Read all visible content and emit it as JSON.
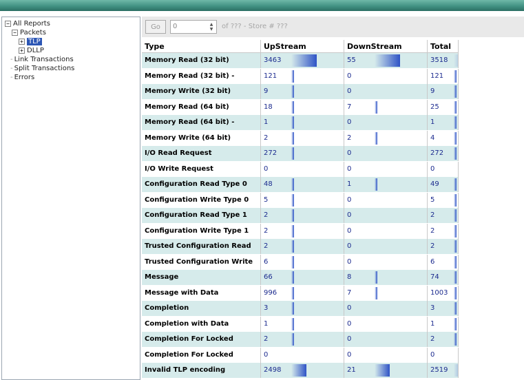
{
  "tree": {
    "root": "All Reports",
    "packets": "Packets",
    "tlp": "TLP",
    "dllp": "DLLP",
    "link": "Link Transactions",
    "split": "Split Transactions",
    "errors": "Errors"
  },
  "toolbar": {
    "go_label": "Go",
    "spin_value": "0",
    "of_text": "of ??? - Store # ???"
  },
  "table": {
    "headers": [
      "Type",
      "UpStream",
      "DownStream",
      "Total"
    ],
    "rows": [
      {
        "type": "Memory Read (32 bit)",
        "up": "3463",
        "down": "55",
        "total": "3518",
        "up_frac": 0.6,
        "down_frac": 0.6,
        "total_frac": 1.0
      },
      {
        "type": "Memory Read (32 bit) -",
        "up": "121",
        "down": "0",
        "total": "121",
        "up_frac": 0.05,
        "down_frac": 0,
        "total_frac": 0.05
      },
      {
        "type": "Memory Write (32 bit)",
        "up": "9",
        "down": "0",
        "total": "9",
        "up_frac": 0.02,
        "down_frac": 0,
        "total_frac": 0.02
      },
      {
        "type": "Memory Read (64 bit)",
        "up": "18",
        "down": "7",
        "total": "25",
        "up_frac": 0.02,
        "down_frac": 0.05,
        "total_frac": 0.02
      },
      {
        "type": "Memory Read (64 bit) -",
        "up": "1",
        "down": "0",
        "total": "1",
        "up_frac": 0.02,
        "down_frac": 0,
        "total_frac": 0.02
      },
      {
        "type": "Memory Write (64 bit)",
        "up": "2",
        "down": "2",
        "total": "4",
        "up_frac": 0.02,
        "down_frac": 0.02,
        "total_frac": 0.02
      },
      {
        "type": "I/O Read Request",
        "up": "272",
        "down": "0",
        "total": "272",
        "up_frac": 0.05,
        "down_frac": 0,
        "total_frac": 0.05
      },
      {
        "type": "I/O Write Request",
        "up": "0",
        "down": "0",
        "total": "0",
        "up_frac": 0,
        "down_frac": 0,
        "total_frac": 0
      },
      {
        "type": "Configuration Read Type 0",
        "up": "48",
        "down": "1",
        "total": "49",
        "up_frac": 0.02,
        "down_frac": 0.05,
        "total_frac": 0.02
      },
      {
        "type": "Configuration Write Type 0",
        "up": "5",
        "down": "0",
        "total": "5",
        "up_frac": 0.02,
        "down_frac": 0,
        "total_frac": 0.02
      },
      {
        "type": "Configuration Read Type 1",
        "up": "2",
        "down": "0",
        "total": "2",
        "up_frac": 0.02,
        "down_frac": 0,
        "total_frac": 0.02
      },
      {
        "type": "Configuration Write Type 1",
        "up": "2",
        "down": "0",
        "total": "2",
        "up_frac": 0.02,
        "down_frac": 0,
        "total_frac": 0.02
      },
      {
        "type": "Trusted Configuration Read",
        "up": "2",
        "down": "0",
        "total": "2",
        "up_frac": 0.02,
        "down_frac": 0,
        "total_frac": 0.02
      },
      {
        "type": "Trusted Configuration Write",
        "up": "6",
        "down": "0",
        "total": "6",
        "up_frac": 0.02,
        "down_frac": 0,
        "total_frac": 0.02
      },
      {
        "type": "Message",
        "up": "66",
        "down": "8",
        "total": "74",
        "up_frac": 0.02,
        "down_frac": 0.05,
        "total_frac": 0.02
      },
      {
        "type": "Message with Data",
        "up": "996",
        "down": "7",
        "total": "1003",
        "up_frac": 0.05,
        "down_frac": 0.05,
        "total_frac": 0.05
      },
      {
        "type": "Completion",
        "up": "3",
        "down": "0",
        "total": "3",
        "up_frac": 0.02,
        "down_frac": 0,
        "total_frac": 0.02
      },
      {
        "type": "Completion with Data",
        "up": "1",
        "down": "0",
        "total": "1",
        "up_frac": 0.02,
        "down_frac": 0,
        "total_frac": 0.02
      },
      {
        "type": "Completion For Locked",
        "up": "2",
        "down": "0",
        "total": "2",
        "up_frac": 0.02,
        "down_frac": 0,
        "total_frac": 0.02
      },
      {
        "type": "Completion For Locked",
        "up": "0",
        "down": "0",
        "total": "0",
        "up_frac": 0,
        "down_frac": 0,
        "total_frac": 0
      },
      {
        "type": "Invalid TLP encoding",
        "up": "2498",
        "down": "21",
        "total": "2519",
        "up_frac": 0.35,
        "down_frac": 0.35,
        "total_frac": 0.7
      }
    ]
  },
  "colors": {
    "row_alt": "#d6ebeb",
    "bar": "#2e53c6",
    "selection": "#2c56b5"
  }
}
